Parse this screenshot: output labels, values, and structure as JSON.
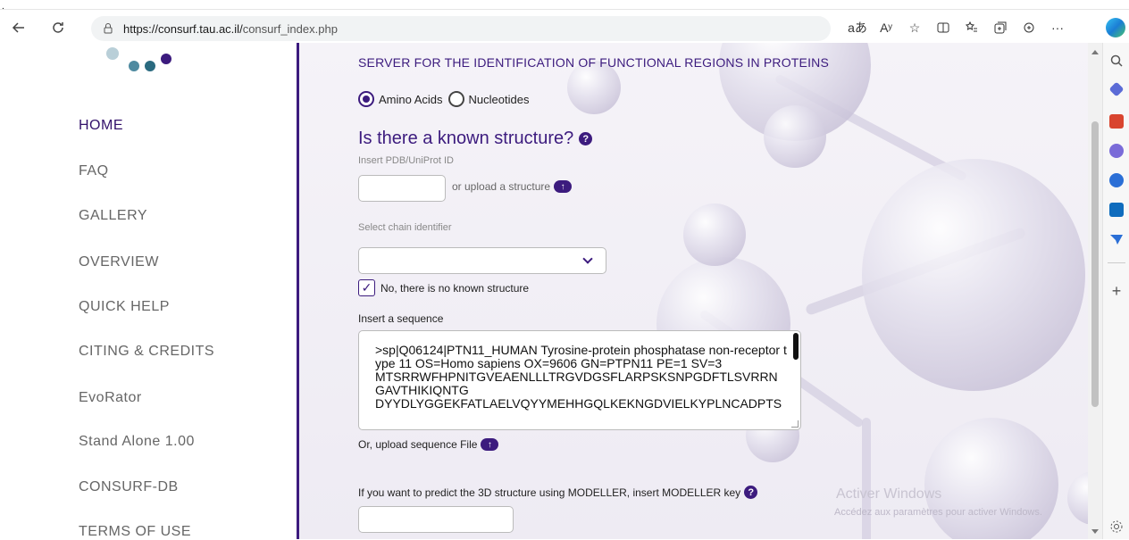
{
  "top_marker": ".",
  "browser": {
    "url_host": "https://consurf.tau.ac.il/",
    "url_path": "consurf_index.php",
    "read_aloud_label": "aあ",
    "text_size_label": "Aʸ",
    "more_label": "···"
  },
  "nav": {
    "items": [
      {
        "label": "HOME",
        "active": true
      },
      {
        "label": "FAQ"
      },
      {
        "label": "GALLERY"
      },
      {
        "label": "OVERVIEW"
      },
      {
        "label": "QUICK HELP"
      },
      {
        "label": "CITING & CREDITS"
      },
      {
        "label": "EvoRator"
      },
      {
        "label": "Stand Alone 1.00"
      },
      {
        "label": "CONSURF-DB"
      },
      {
        "label": "TERMS OF USE"
      }
    ]
  },
  "main": {
    "headline": "SERVER FOR THE IDENTIFICATION OF FUNCTIONAL REGIONS IN PROTEINS",
    "radio_amino": "Amino Acids",
    "radio_nucleotides": "Nucleotides",
    "structure_question": "Is there a known structure?",
    "help_glyph": "?",
    "pdb_label": "Insert PDB/UniProt ID",
    "upload_structure": "or upload a structure",
    "chain_label": "Select chain identifier",
    "no_structure_label": "No, there is no known structure",
    "sequence_label": "Insert a sequence",
    "sequence_text": ">sp|Q06124|PTN11_HUMAN Tyrosine-protein phosphatase non-receptor type 11 OS=Homo sapiens OX=9606 GN=PTPN11 PE=1 SV=3\nMTSRRWFHPNITGVEAENLLLTRGVDGSFLARPSKSNPGDFTLSVRRN GAVTHIKIQNTG\nDYYDLYGGEKFATLAELVQYYMEHHGQLKEKNGDVIELKYPLNCADPTS",
    "upload_sequence": "Or, upload sequence File",
    "modeller_label": "If you want to predict the 3D structure using MODELLER, insert MODELLER key"
  },
  "watermark": {
    "line1": "Activer Windows",
    "line2": "Accédez aux paramètres pour activer Windows."
  },
  "colors": {
    "accent": "#3c1b7e",
    "nav_text": "#666666"
  }
}
